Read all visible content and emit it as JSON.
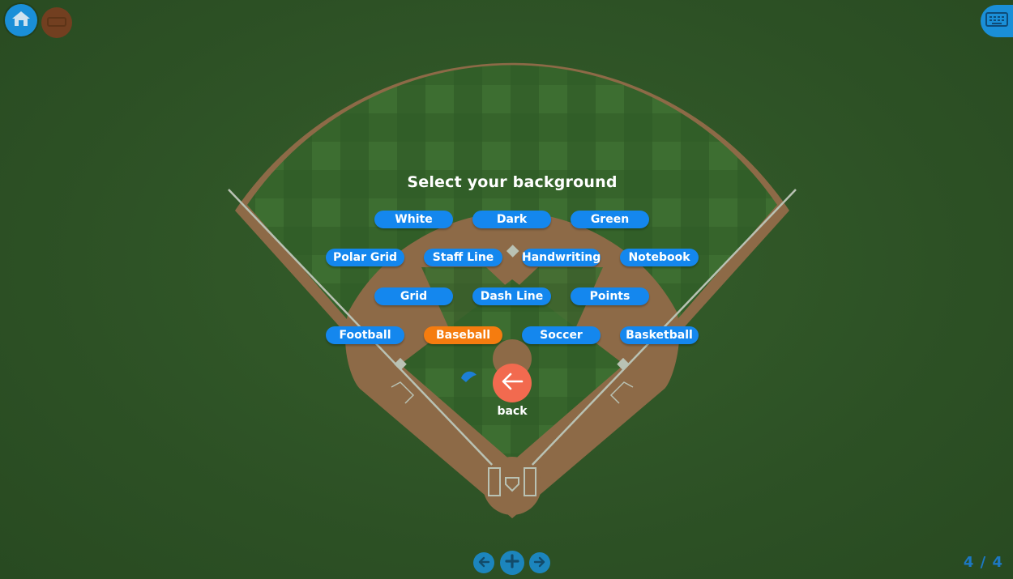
{
  "toolbar": {
    "home_icon": "home-icon",
    "stop_icon": "stop-icon",
    "keyboard_icon": "keyboard-icon"
  },
  "menu": {
    "title": "Select your background",
    "options": [
      {
        "label": "White",
        "selected": false
      },
      {
        "label": "Dark",
        "selected": false
      },
      {
        "label": "Green",
        "selected": false
      },
      {
        "label": "Polar Grid",
        "selected": false
      },
      {
        "label": "Staff Line",
        "selected": false
      },
      {
        "label": "Handwriting",
        "selected": false
      },
      {
        "label": "Notebook",
        "selected": false
      },
      {
        "label": "Grid",
        "selected": false
      },
      {
        "label": "Dash Line",
        "selected": false
      },
      {
        "label": "Points",
        "selected": false
      },
      {
        "label": "Football",
        "selected": false
      },
      {
        "label": "Baseball",
        "selected": true
      },
      {
        "label": "Soccer",
        "selected": false
      },
      {
        "label": "Basketball",
        "selected": false
      }
    ],
    "back_label": "back"
  },
  "pagination": {
    "indicator": "4 / 4"
  },
  "colors": {
    "button": "#1487ee",
    "selected_button": "#f57c0f",
    "back_button": "#f26a4f",
    "field_grass": "#2e5226",
    "field_dirt": "#8a6a45"
  }
}
